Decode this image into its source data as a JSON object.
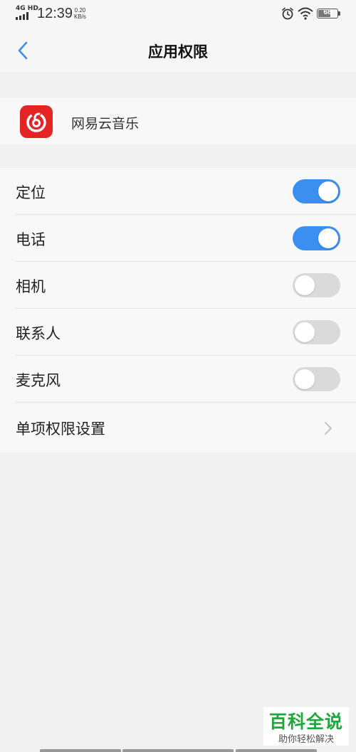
{
  "status_bar": {
    "network": "4G HD",
    "time": "12:39",
    "speed_value": "0.20",
    "speed_unit": "KB/s",
    "battery_level": "68",
    "battery_fraction": 0.68
  },
  "header": {
    "back_icon": "chevron-left-icon",
    "title": "应用权限"
  },
  "app": {
    "name": "网易云音乐",
    "icon": "netease-cloud-music-icon",
    "icon_color": "#e52424"
  },
  "permissions": [
    {
      "label": "定位",
      "enabled": true
    },
    {
      "label": "电话",
      "enabled": true
    },
    {
      "label": "相机",
      "enabled": false
    },
    {
      "label": "联系人",
      "enabled": false
    },
    {
      "label": "麦克风",
      "enabled": false
    }
  ],
  "individual_settings": {
    "label": "单项权限设置",
    "icon": "chevron-right-icon"
  },
  "colors": {
    "accent": "#3a8ff0",
    "toggle_off": "#dadada",
    "watermark_green": "#1ea73a"
  },
  "watermark": {
    "title": "百科全说",
    "subtitle": "助你轻松解决"
  }
}
